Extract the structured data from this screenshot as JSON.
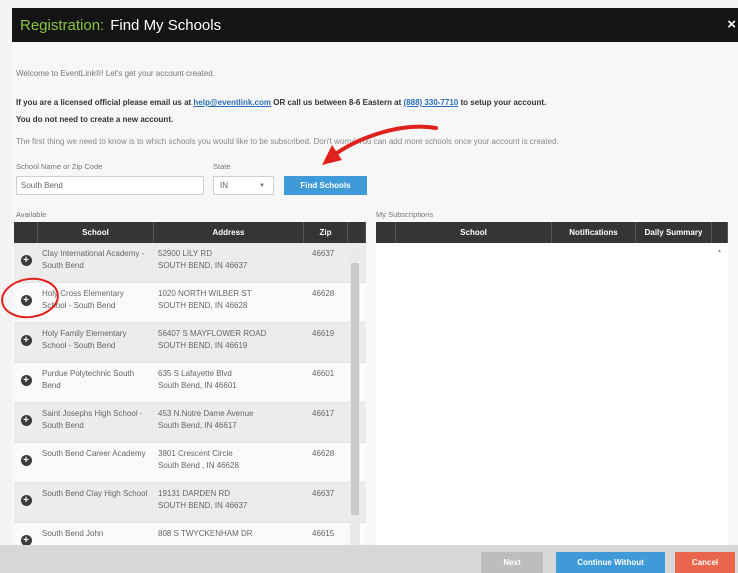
{
  "dialog": {
    "title_prefix": "Registration:",
    "title": "Find My Schools",
    "close_label": "×"
  },
  "intro": {
    "welcome": "Welcome to EventLink®! Let's get your account created.",
    "licensed_before": "If you are a licensed official please email us at ",
    "email": "help@eventlink.com",
    "licensed_middle": " OR call us between 8-6 Eastern at ",
    "phone": "(888) 330-7710",
    "licensed_after": " to setup your account.",
    "no_new_account": "You do not need to create a new account.",
    "first_thing": "The first thing we need to know is to which schools you would like to be subscribed. Don't worry! You can add more schools once your account is created."
  },
  "search": {
    "school_label": "School Name or Zip Code",
    "school_value": "South Bend",
    "state_label": "State",
    "state_value": "IN",
    "find_button": "Find Schools"
  },
  "available": {
    "label": "Available",
    "columns": {
      "school": "School",
      "address": "Address",
      "zip": "Zip"
    },
    "rows": [
      {
        "school": "Clay International Academy - South Bend",
        "addr1": "52900 LILY RD",
        "addr2": "SOUTH BEND, IN 46637",
        "zip": "46637"
      },
      {
        "school": "Holy Cross Elementary School - South Bend",
        "addr1": "1020 NORTH WILBER ST",
        "addr2": "SOUTH BEND, IN 46628",
        "zip": "46628"
      },
      {
        "school": "Holy Family Elementary School - South Bend",
        "addr1": "56407 S MAYFLOWER ROAD",
        "addr2": "SOUTH BEND, IN 46619",
        "zip": "46619"
      },
      {
        "school": "Purdue Polytechnic South Bend",
        "addr1": "635 S Lafayette Blvd",
        "addr2": "South Bend, IN 46601",
        "zip": "46601"
      },
      {
        "school": "Saint Josephs High School - South Bend",
        "addr1": "453 N.Notre Dame Avenue",
        "addr2": "South Bend, IN 46617",
        "zip": "46617"
      },
      {
        "school": "South Bend Career Academy",
        "addr1": "3801 Crescent Circle",
        "addr2": "South Bend , IN 46628",
        "zip": "46628"
      },
      {
        "school": "South Bend Clay High School",
        "addr1": "19131 DARDEN RD",
        "addr2": "SOUTH BEND, IN 46637",
        "zip": "46637"
      },
      {
        "school": "South Bend John",
        "addr1": "808 S TWYCKENHAM DR",
        "addr2": "",
        "zip": "46615"
      }
    ]
  },
  "subscriptions": {
    "label": "My Subscriptions",
    "columns": {
      "school": "School",
      "notifications": "Notifications",
      "daily": "Daily Summary"
    },
    "scroll_arrow": "▲"
  },
  "footer": {
    "next": "Next",
    "continue": "Continue Without",
    "cancel": "Cancel"
  },
  "colors": {
    "title_accent": "#8cc63f",
    "primary": "#3f9ad8",
    "cancel": "#e9664c",
    "annotation": "#e0201a"
  },
  "icons": {
    "add_school": "plus-circle-icon",
    "select_arrow": "caret-down-icon"
  }
}
